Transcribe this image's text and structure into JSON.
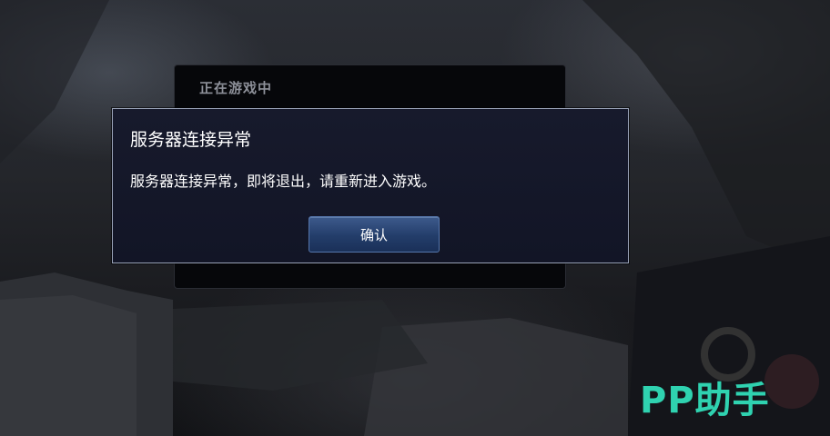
{
  "background_panel": {
    "title": "正在游戏中"
  },
  "dialog": {
    "title": "服务器连接异常",
    "message": "服务器连接异常，即将退出，请重新进入游戏。",
    "confirm_label": "确认"
  },
  "watermark": {
    "text": "PP助手",
    "color": "#2fd2b0"
  },
  "colors": {
    "dialog_bg": "#151829",
    "button": "#2a4577",
    "accent": "#2fd2b0"
  }
}
